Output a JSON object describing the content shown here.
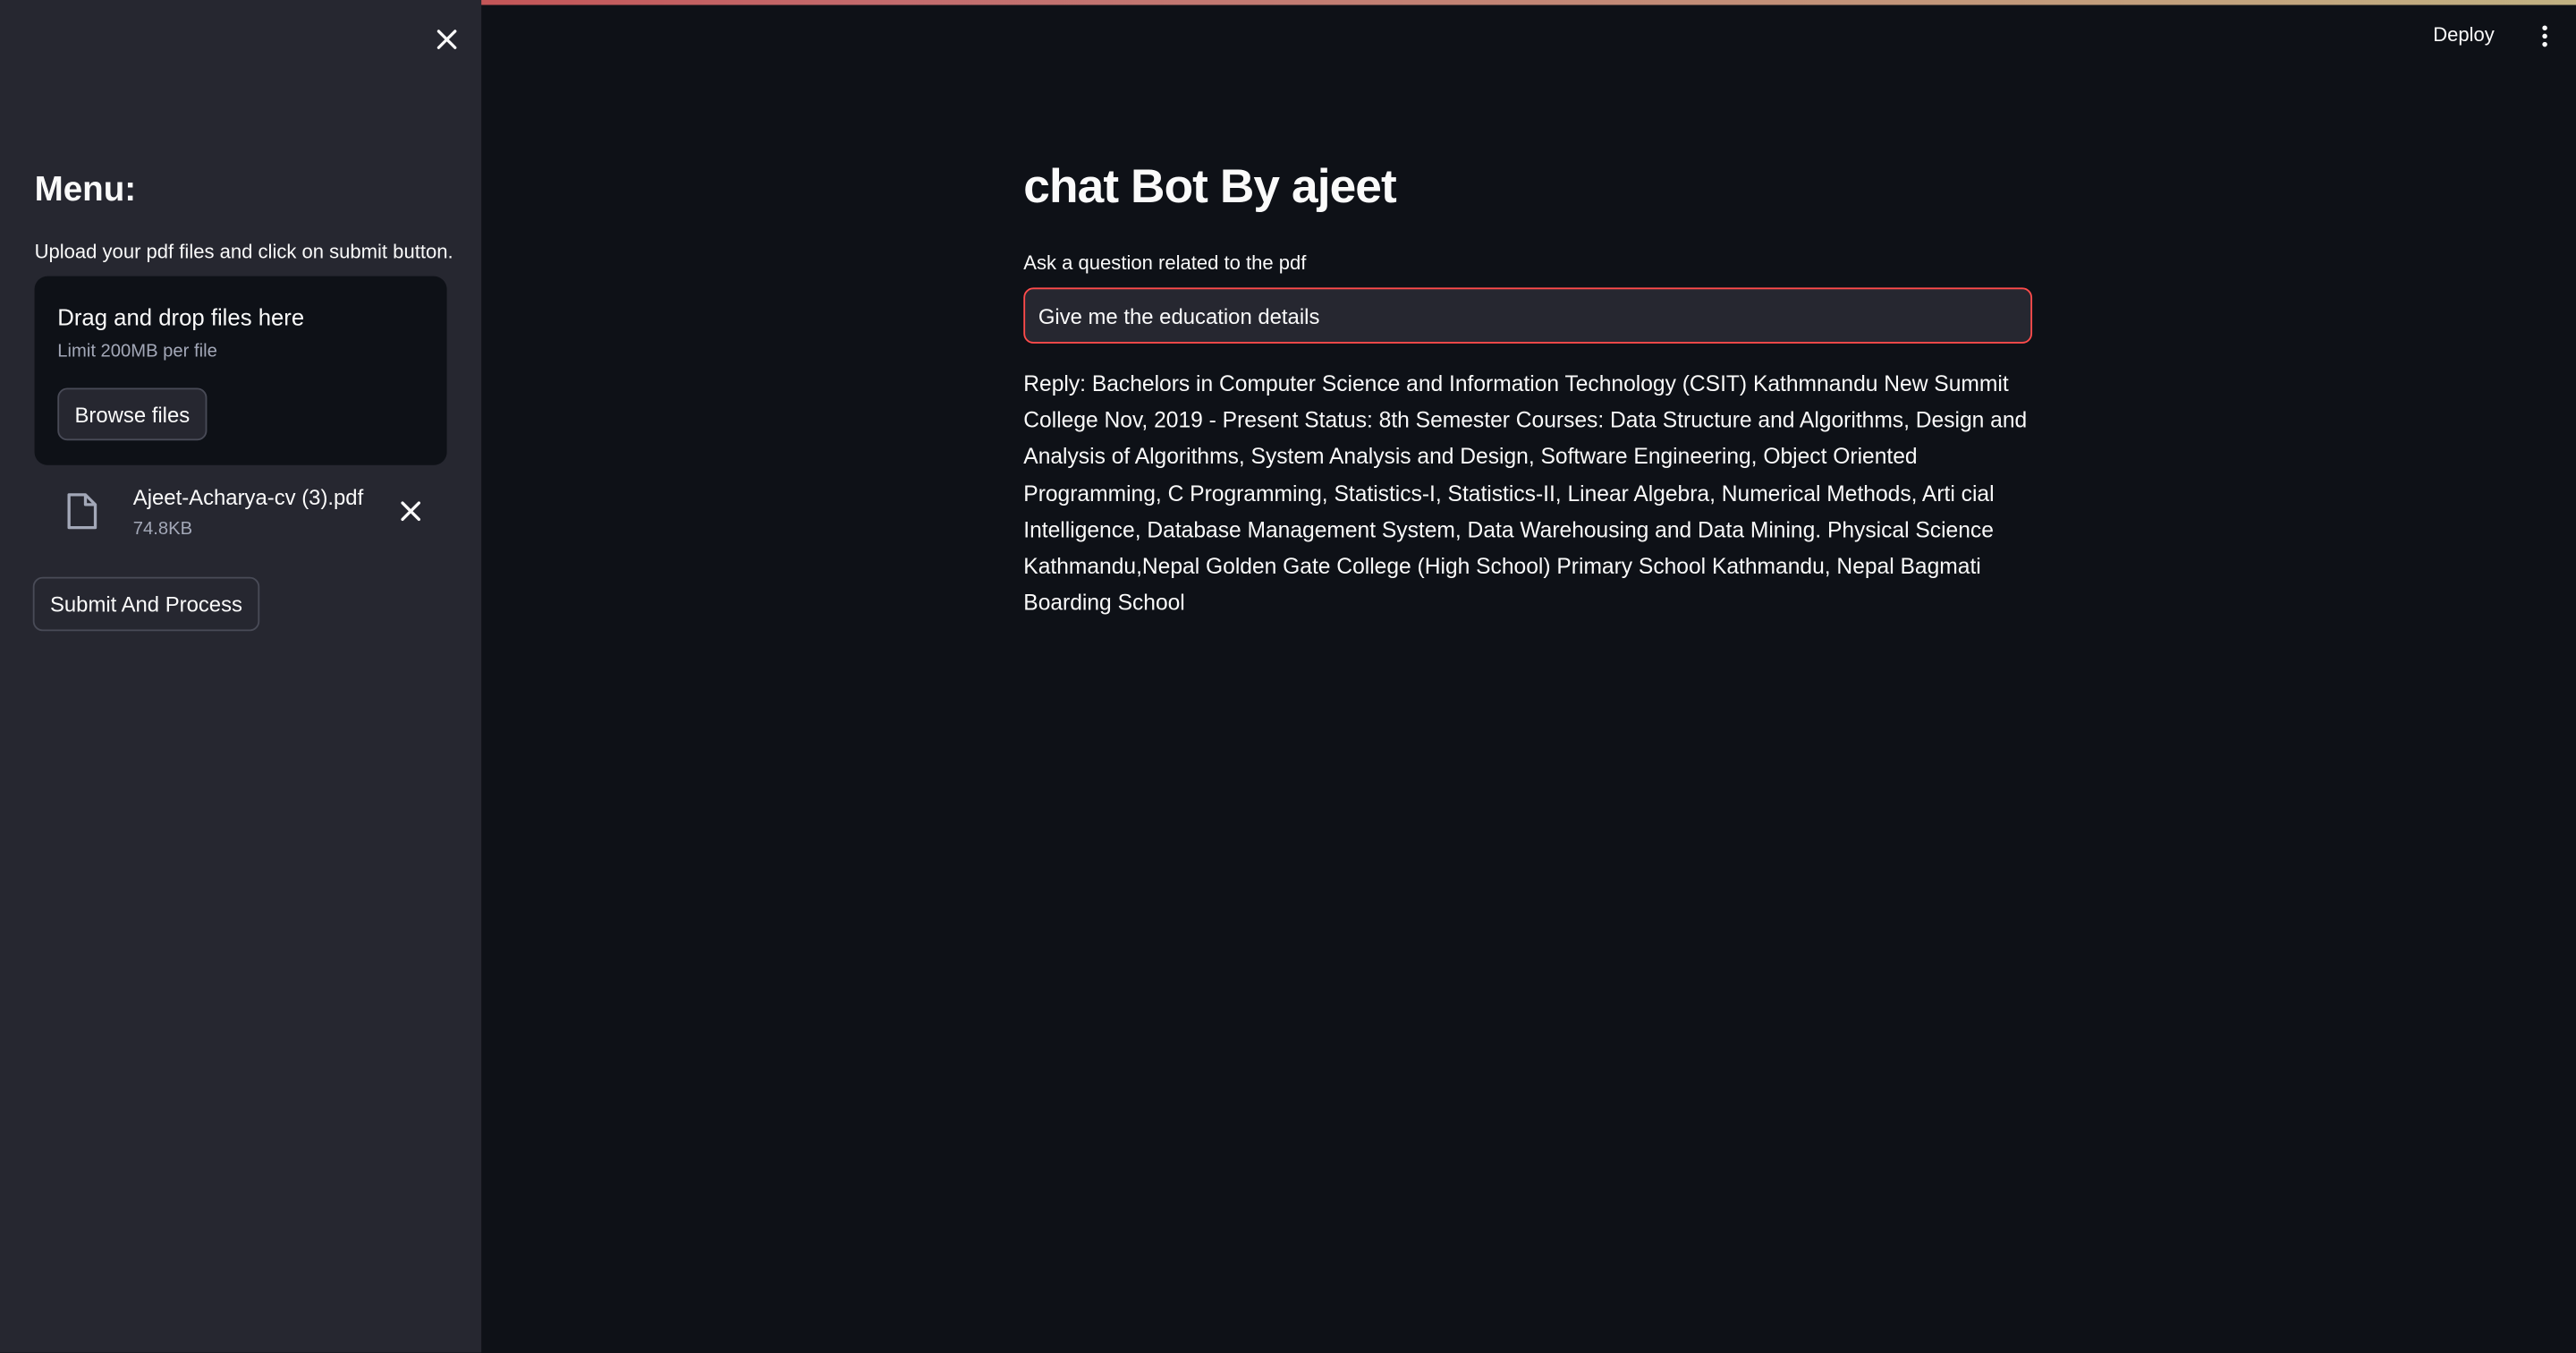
{
  "header": {
    "deploy_label": "Deploy",
    "more_icon": "kebab-menu-icon"
  },
  "sidebar": {
    "close_icon": "close-icon",
    "menu_title": "Menu:",
    "upload_instruction": "Upload your pdf files and click on submit button.",
    "dropzone": {
      "title": "Drag and drop files here",
      "limit": "Limit 200MB per file",
      "browse_label": "Browse files"
    },
    "uploaded_file": {
      "icon": "file-icon",
      "name": "Ajeet-Acharya-cv (3).pdf",
      "size": "74.8KB",
      "remove_icon": "close-icon"
    },
    "submit_label": "Submit And Process"
  },
  "main": {
    "title": "chat Bot By ajeet",
    "question_label": "Ask a question related to the pdf",
    "question_value": "Give me the education details",
    "reply": "Reply: Bachelors in Computer Science and Information Technology (CSIT) Kathmnandu New Summit College Nov, 2019 - Present Status: 8th Semester Courses: Data Structure and Algorithms, Design and Analysis of Algorithms, System Analysis and Design, Software Engineering, Object Oriented Programming, C Programming, Statistics-I, Statistics-II, Linear Algebra, Numerical Methods, Arti cial Intelligence, Database Management System, Data Warehousing and Data Mining.  Physical Science Kathmandu,Nepal Golden Gate College (High School) Primary School Kathmandu, Nepal Bagmati Boarding School"
  },
  "colors": {
    "background": "#0e1117",
    "sidebar": "#262730",
    "accent": "#ff4b4b",
    "text": "#fafafa",
    "muted_text": "#a3a8b8"
  }
}
